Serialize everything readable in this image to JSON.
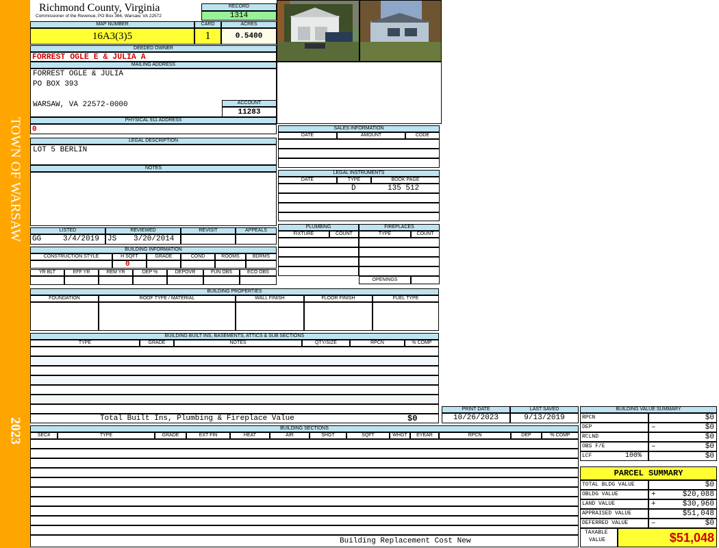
{
  "sidebar": {
    "town": "TOWN OF WARSAW",
    "year": "2023"
  },
  "header": {
    "county": "Richmond County, Virginia",
    "commissioner": "Commissioner of the Revenue, PO Box 366, Warsaw, VA 22572"
  },
  "record": {
    "label": "RECORD",
    "value": "1314"
  },
  "map": {
    "label": "MAP NUMBER",
    "value": "16A3(3)5"
  },
  "card": {
    "label": "CARD",
    "value": "1"
  },
  "acres": {
    "label": "ACRES",
    "value": "0.5400"
  },
  "owner": {
    "label": "DEEDED OWNER",
    "value": "FORREST OGLE E & JULIA A"
  },
  "mailing": {
    "label": "MAILING ADDRESS",
    "line1": "FORREST OGLE & JULIA",
    "line2": "PO BOX 393",
    "line3": "WARSAW, VA 22572-0000"
  },
  "account": {
    "label": "ACCOUNT",
    "value": "11283"
  },
  "physical": {
    "label": "PHYSICAL 911 ADDRESS",
    "value": "0"
  },
  "legal": {
    "label": "LEGAL DESCRIPTION",
    "value": "LOT 5 BERLIN"
  },
  "notes": {
    "label": "NOTES"
  },
  "listing": {
    "listed_label": "LISTED",
    "reviewed_label": "REVIEWED",
    "revisit_label": "REVISIT",
    "appeals_label": "APPEALS",
    "listed_by": "GG",
    "listed_date": "3/4/2019",
    "reviewed_by": "JS",
    "reviewed_date": "3/20/2014"
  },
  "building_info": {
    "label": "BUILDING INFORMATION",
    "cols1": [
      "CONSTRUCTION STYLE",
      "H SQFT",
      "GRADE",
      "COND",
      "ROOMS",
      "BDRMS"
    ],
    "hsqft": "0",
    "cols2": [
      "YR BLT",
      "EFF YR",
      "REM YR",
      "DEP %",
      "DEPOVR",
      "FUN OBS",
      "ECO OBS"
    ]
  },
  "sales": {
    "label": "SALES INFORMATION",
    "cols": [
      "DATE",
      "AMOUNT",
      "CODE"
    ]
  },
  "instruments": {
    "label": "LEGAL INSTRUMENTS",
    "cols": [
      "DATE",
      "TYPE",
      "BOOK PAGE"
    ],
    "type": "D",
    "book": "135 512"
  },
  "plumbing": {
    "label": "PLUMBING",
    "cols": [
      "FIXTURE",
      "COUNT"
    ]
  },
  "fireplaces": {
    "label": "FIREPLACES",
    "cols": [
      "TYPE",
      "COUNT"
    ],
    "openings": "OPENINGS"
  },
  "properties": {
    "label": "BUILDING PROPERTIES",
    "cols": [
      "FOUNDATION",
      "ROOF TYPE / MATERIAL",
      "WALL FINISH",
      "FLOOR FINISH",
      "FUEL TYPE"
    ]
  },
  "builtins": {
    "label": "BUILDING BUILT INS, BASEMENTS, ATTICS & SUB SECTIONS",
    "cols": [
      "TYPE",
      "GRADE",
      "NOTES",
      "QTY/SIZE",
      "RPCN",
      "% COMP"
    ],
    "total_label": "Total Built Ins, Plumbing & Fireplace Value",
    "total_value": "$0"
  },
  "print": {
    "print_label": "PRINT DATE",
    "print_date": "10/26/2023",
    "saved_label": "LAST SAVED",
    "saved_date": "9/13/2019"
  },
  "sections": {
    "label": "BUILDING SECTIONS",
    "cols": [
      "SEC#",
      "TYPE",
      "GRADE",
      "EXT FIN",
      "HEAT",
      "AIR",
      "SHGT",
      "SQFT",
      "WHGT",
      "EYEAR",
      "RPCN",
      "DEP",
      "% COMP"
    ],
    "footer": "Building Replacement Cost New"
  },
  "bvs": {
    "label": "BUILDING VALUE SUMMARY",
    "rows": [
      {
        "name": "RPCN",
        "sign": "",
        "value": "$0"
      },
      {
        "name": "DEP",
        "sign": "–",
        "value": "$0"
      },
      {
        "name": "RCLND",
        "sign": "",
        "value": "$0"
      },
      {
        "name": "OBS F/E",
        "sign": "–",
        "value": "$0"
      },
      {
        "name": "LCF",
        "pct": "100%",
        "sign": "",
        "value": "$0"
      }
    ]
  },
  "parcel": {
    "label": "PARCEL SUMMARY",
    "rows": [
      {
        "name": "TOTAL BLDG VALUE",
        "sign": "",
        "value": "$0"
      },
      {
        "name": "OBLDG VALUE",
        "sign": "+",
        "value": "$20,088"
      },
      {
        "name": "LAND VALUE",
        "sign": "+",
        "value": "$30,960"
      },
      {
        "name": "APPRAISED VALUE",
        "sign": "",
        "value": "$51,048"
      },
      {
        "name": "DEFERRED VALUE",
        "sign": "–",
        "value": "$0"
      }
    ],
    "taxable_label1": "TAXABLE",
    "taxable_label2": "VALUE",
    "taxable_value": "$51,048"
  },
  "colors": {
    "sidebar": "#ffa500",
    "header_blue": "#bde3f0",
    "record_green": "#98f098",
    "yellow": "#ffff33",
    "red": "#d00000"
  }
}
